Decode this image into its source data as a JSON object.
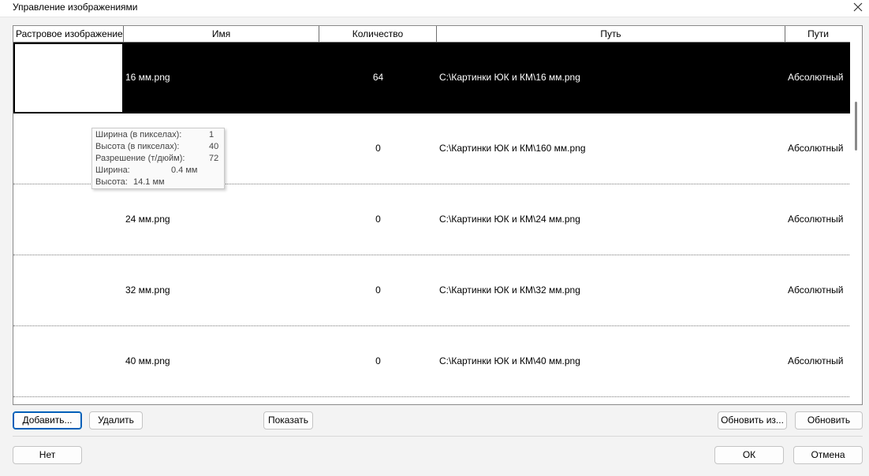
{
  "window": {
    "title": "Управление изображениями"
  },
  "table": {
    "headers": [
      "Растровое изображение",
      "Имя",
      "Количество",
      "Путь",
      "Пути"
    ],
    "rows": [
      {
        "name": "16 мм.png",
        "count": "64",
        "path": "C:\\Картинки ЮК и КМ\\16 мм.png",
        "type": "Абсолютный"
      },
      {
        "name": "",
        "count": "0",
        "path": "C:\\Картинки ЮК и КМ\\160 мм.png",
        "type": "Абсолютный"
      },
      {
        "name": "24 мм.png",
        "count": "0",
        "path": "C:\\Картинки ЮК и КМ\\24 мм.png",
        "type": "Абсолютный"
      },
      {
        "name": "32 мм.png",
        "count": "0",
        "path": "C:\\Картинки ЮК и КМ\\32 мм.png",
        "type": "Абсолютный"
      },
      {
        "name": "40 мм.png",
        "count": "0",
        "path": "C:\\Картинки ЮК и КМ\\40 мм.png",
        "type": "Абсолютный"
      }
    ]
  },
  "tooltip": {
    "width_px_label": "Ширина (в пикселах):",
    "width_px_value": "1",
    "height_px_label": "Высота (в пикселах):",
    "height_px_value": "40",
    "resolution_label": "Разрешение (т/дюйм):",
    "resolution_value": "72",
    "width_label": "Ширина:",
    "width_value": "0.4 мм",
    "height_label": "Высота:",
    "height_value": "14.1 мм"
  },
  "buttons": {
    "add": "Добавить...",
    "delete": "Удалить",
    "show": "Показать",
    "update_from": "Обновить из...",
    "update": "Обновить",
    "no": "Нет",
    "ok": "ОК",
    "cancel": "Отмена"
  },
  "colors": {
    "selected_bg": "#000000",
    "accent": "#005fb8"
  },
  "icons": {
    "close": "close-icon"
  }
}
